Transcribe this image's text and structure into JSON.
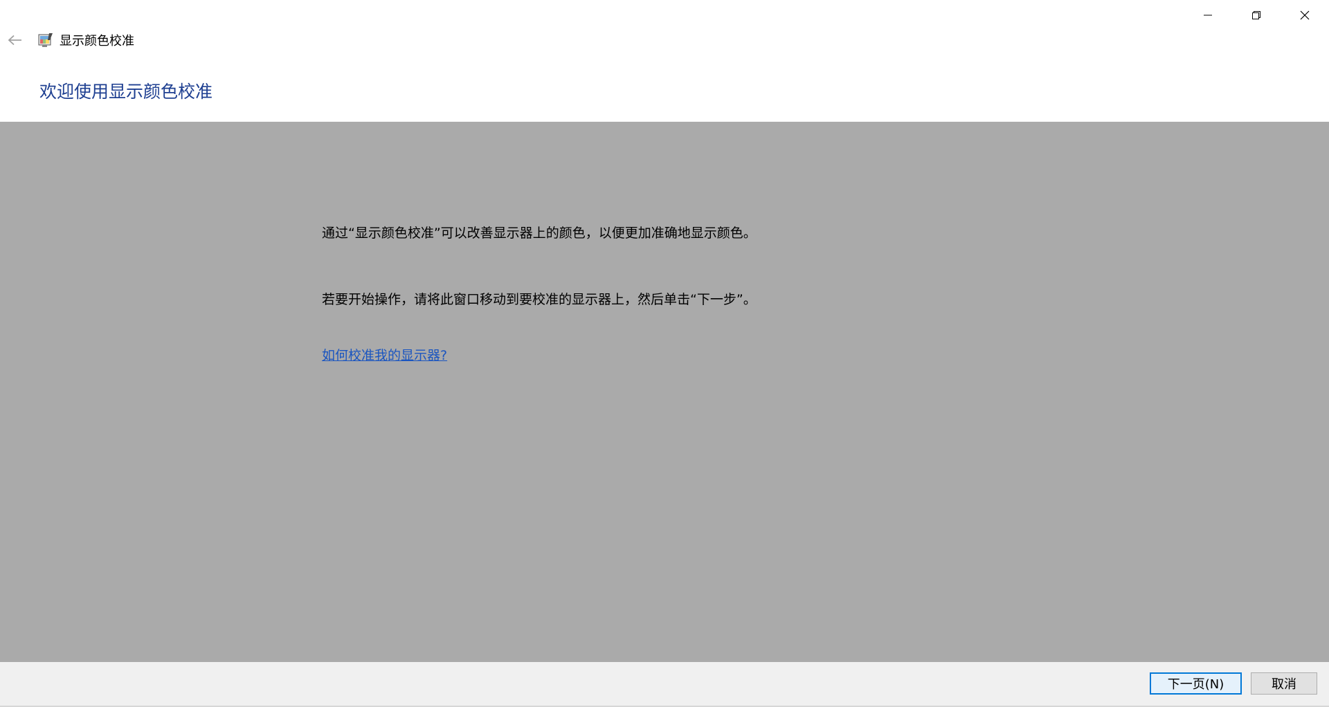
{
  "window": {
    "app_title": "显示颜色校准",
    "controls": {
      "minimize_icon": "minimize-icon",
      "restore_icon": "restore-icon",
      "close_icon": "close-icon"
    }
  },
  "nav": {
    "back_icon": "back-arrow-icon",
    "app_icon": "display-color-calibration-icon"
  },
  "header": {
    "heading": "欢迎使用显示颜色校准"
  },
  "main": {
    "paragraph_1": "通过“显示颜色校准”可以改善显示器上的颜色，以便更加准确地显示颜色。",
    "paragraph_2": "若要开始操作，请将此窗口移动到要校准的显示器上，然后单击“下一步”。",
    "help_link": "如何校准我的显示器?"
  },
  "footer": {
    "next_label": "下一页(N)",
    "cancel_label": "取消"
  },
  "colors": {
    "heading": "#1e3f91",
    "content_bg": "#aaaaaa",
    "link": "#1a55c0",
    "footer_bg": "#f0f0f0",
    "accent": "#0078d7"
  }
}
